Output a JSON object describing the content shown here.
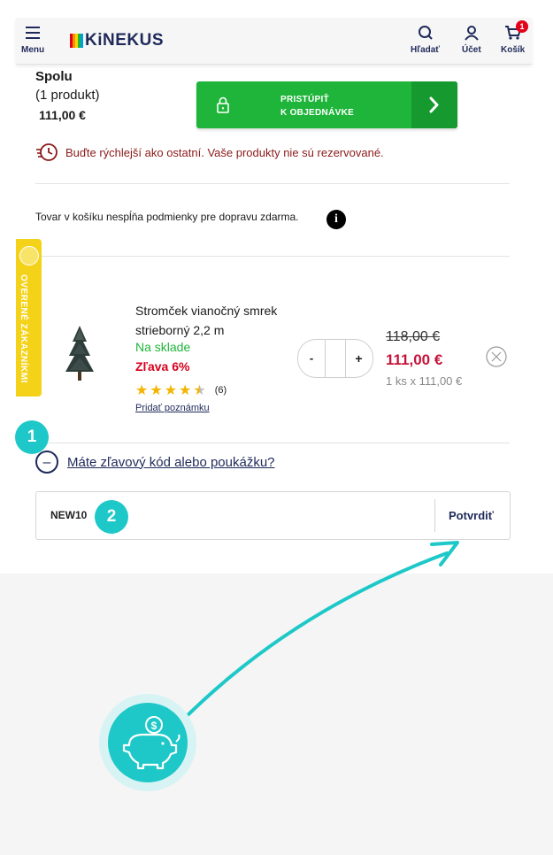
{
  "header": {
    "menu_label": "Menu",
    "logo_text": "KiNEKUS",
    "search_label": "Hľadať",
    "account_label": "Účet",
    "cart_label": "Košík",
    "cart_count": "1"
  },
  "summary": {
    "title": "Spolu",
    "product_count": "(1 produkt)",
    "total": "111,00 €",
    "checkout_line1": "PRISTÚPIŤ",
    "checkout_line2": "K OBJEDNÁVKE"
  },
  "warning": "Buďte rýchlejší ako ostatní. Vaše produkty nie sú rezervované.",
  "shipping_note": "Tovar v košíku nespĺňa podmienky pre dopravu zdarma.",
  "side_badge": "OVERENÉ ZÁKAZNÍKMI",
  "product": {
    "name": "Stromček vianočný smrek strieborný 2,2 m",
    "stock": "Na sklade",
    "discount": "Zľava 6%",
    "rating": 4.5,
    "review_count": "(6)",
    "note_link": "Pridať poznámku",
    "quantity": "",
    "minus": "-",
    "plus": "+",
    "old_price": "118,00 €",
    "new_price": "111,00 €",
    "unit_price": "1 ks x 111,00 €"
  },
  "coupon": {
    "toggle_label": "Máte zľavový kód alebo poukážku?",
    "code_value": "NEW10",
    "confirm_label": "Potvrdiť"
  },
  "steps": {
    "step1": "1",
    "step2": "2"
  },
  "colors": {
    "accent_green": "#1eb53a",
    "brand_navy": "#1f2a5a",
    "price_red": "#c7133a",
    "annotation_teal": "#1ec8c8"
  }
}
